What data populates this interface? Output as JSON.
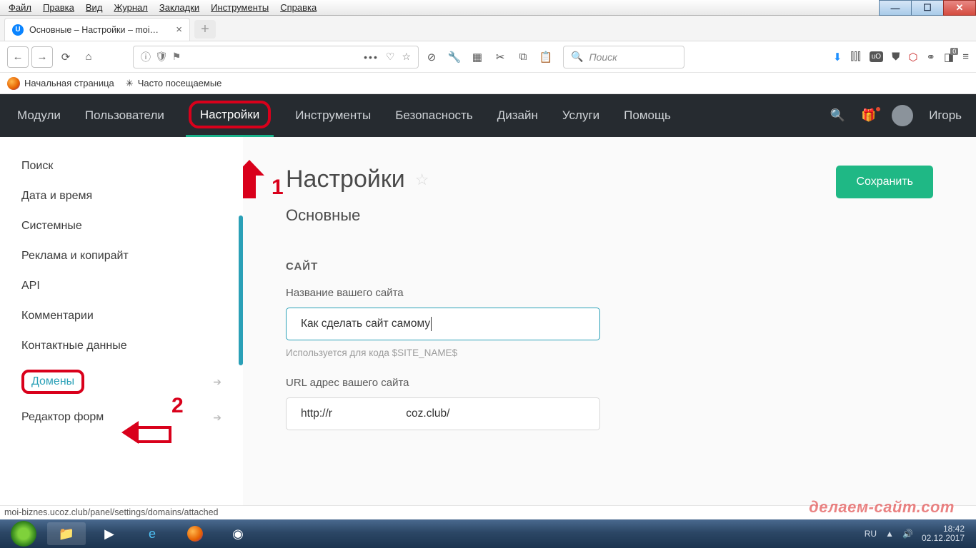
{
  "win_menu": [
    "Файл",
    "Правка",
    "Вид",
    "Журнал",
    "Закладки",
    "Инструменты",
    "Справка"
  ],
  "tab_title": "Основные – Настройки – moi…",
  "bookmarks": {
    "start": "Начальная страница",
    "frequent": "Часто посещаемые"
  },
  "search_placeholder": "Поиск",
  "site_nav": {
    "items": [
      "Модули",
      "Пользователи",
      "Настройки",
      "Инструменты",
      "Безопасность",
      "Дизайн",
      "Услуги",
      "Помощь"
    ],
    "active_index": 2,
    "user": "Игорь"
  },
  "sidebar": {
    "items": [
      {
        "label": "Поиск"
      },
      {
        "label": "Дата и время"
      },
      {
        "label": "Системные"
      },
      {
        "label": "Реклама и копирайт"
      },
      {
        "label": "API"
      },
      {
        "label": "Комментарии"
      },
      {
        "label": "Контактные данные"
      },
      {
        "label": "Домены",
        "link": true,
        "chev": true,
        "highlight": true
      },
      {
        "label": "Редактор форм",
        "chev": true
      }
    ]
  },
  "page": {
    "title": "Настройки",
    "subtitle": "Основные",
    "section": "САЙТ",
    "site_name_label": "Название вашего сайта",
    "site_name_value": "Как сделать сайт самому",
    "site_name_hint": "Используется для кода $SITE_NAME$",
    "url_label": "URL адрес вашего сайта",
    "url_value": "http://r                        coz.club/",
    "save": "Сохранить"
  },
  "annotations": {
    "one": "1",
    "two": "2"
  },
  "status_url": "moi-biznes.ucoz.club/panel/settings/domains/attached",
  "tray": {
    "lang": "RU",
    "time": "18:42",
    "date": "02.12.2017"
  },
  "watermark": "делаем-сайт.com"
}
